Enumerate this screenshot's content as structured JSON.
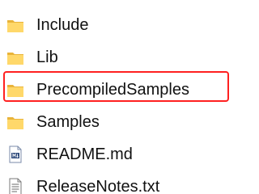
{
  "items": [
    {
      "label": "Include",
      "icon": "folder-icon"
    },
    {
      "label": "Lib",
      "icon": "folder-icon"
    },
    {
      "label": "PrecompiledSamples",
      "icon": "folder-icon",
      "highlighted": true
    },
    {
      "label": "Samples",
      "icon": "folder-icon"
    },
    {
      "label": "README.md",
      "icon": "markdown-file-icon"
    },
    {
      "label": "ReleaseNotes.txt",
      "icon": "text-file-icon"
    }
  ],
  "colors": {
    "folder_light": "#ffd86a",
    "folder_dark": "#e9b43a",
    "highlight_border": "#ff2020",
    "text": "#111111"
  }
}
